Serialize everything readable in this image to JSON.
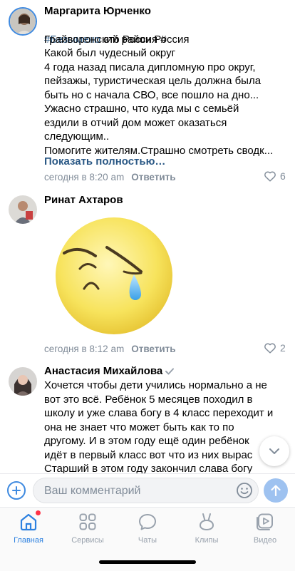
{
  "comments": [
    {
      "author": "Маргарита Юрченко",
      "hashtag": "#Безымено",
      "text_after_hashtag": " это Россия #",
      "text": "Грайворонский район Россия\nКакой был чудесный округ\n4 года назад писала дипломную про округ,\nпейзажы, туристическая цель должна была\nбыть  но с начала СВО, все пошло на дно...\nУжасно страшно, что куда мы с семьёй\nездили в отчий дом может оказаться\nследующим..\nПомогите жителям.Страшно смотреть сводк...",
      "show_more": "Показать полностью…",
      "time": "сегодня в 8:20 am",
      "reply": "Ответить",
      "likes": "6"
    },
    {
      "author": "Ринат Ахтаров",
      "sticker": "crying-face-sticker",
      "time": "сегодня в 8:12 am",
      "reply": "Ответить",
      "likes": "2"
    },
    {
      "author": "Анастасия Михайлова",
      "verified": true,
      "text": "Хочется чтобы дети учились нормально а не\nвот это всё. Ребёнок 5 месяцев походил в\nшколу и уже слава богу в 4 класс переходит и\nона не знает что может быть как то по\nдругому. И в этом году ещё один ребёнок\nидёт в первый класс вот что из них вырас\nСтарший в этом году закончил слава богу"
    }
  ],
  "composer": {
    "placeholder": "Ваш комментарий"
  },
  "tabs": [
    {
      "label": "Главная",
      "icon": "home-icon",
      "active": true
    },
    {
      "label": "Сервисы",
      "icon": "services-icon",
      "active": false
    },
    {
      "label": "Чаты",
      "icon": "chats-icon",
      "active": false
    },
    {
      "label": "Клипы",
      "icon": "clips-icon",
      "active": false
    },
    {
      "label": "Видео",
      "icon": "video-icon",
      "active": false
    }
  ],
  "colors": {
    "accent": "#2d81e0",
    "link": "#2a5885",
    "secondary": "#818c99",
    "notification": "#ff3347"
  }
}
